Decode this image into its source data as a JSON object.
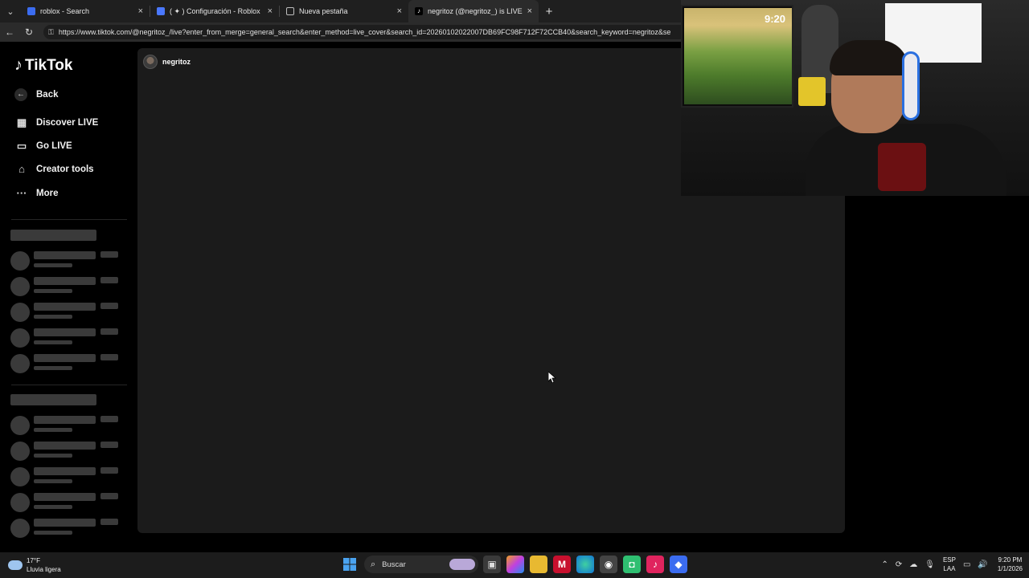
{
  "browser": {
    "tabs": [
      {
        "title": "roblox - Search",
        "favicon_color": "#3b6cf0"
      },
      {
        "title": "( ✦ ) Configuración - Roblox",
        "favicon_color": "#4a78ff"
      },
      {
        "title": "Nueva pestaña",
        "favicon_color": "#bdbdbd"
      },
      {
        "title": "negritoz (@negritoz_) is LIVE - Tik",
        "favicon_color": "#ffffff"
      }
    ],
    "url": "https://www.tiktok.com/@negritoz_/live?enter_from_merge=general_search&enter_method=live_cover&search_id=20260102022007DB69FC98F712F72CCB40&search_keyword=negritoz&se"
  },
  "tiktok": {
    "logo_text": "TikTok",
    "back_label": "Back",
    "nav": [
      {
        "label": "Discover LIVE",
        "icon": "calendar-live-icon"
      },
      {
        "label": "Go LIVE",
        "icon": "video-camera-icon"
      },
      {
        "label": "Creator tools",
        "icon": "home-shield-icon"
      },
      {
        "label": "More",
        "icon": "more-dots-icon"
      }
    ],
    "host_name": "negritoz"
  },
  "webcam": {
    "clock": "9:20"
  },
  "taskbar": {
    "weather_temp": "17°F",
    "weather_desc": "Lluvia ligera",
    "search_placeholder": "Buscar",
    "lang_top": "ESP",
    "lang_bottom": "LAA",
    "time": "9:20 PM",
    "date": "1/1/2026",
    "apps": [
      "start-icon",
      "widget-icon",
      "copilot-icon",
      "file-explorer-icon",
      "mcafee-icon",
      "edge-icon",
      "app-icon",
      "discord-icon",
      "tiktok-app-icon",
      "roblox-icon"
    ]
  }
}
